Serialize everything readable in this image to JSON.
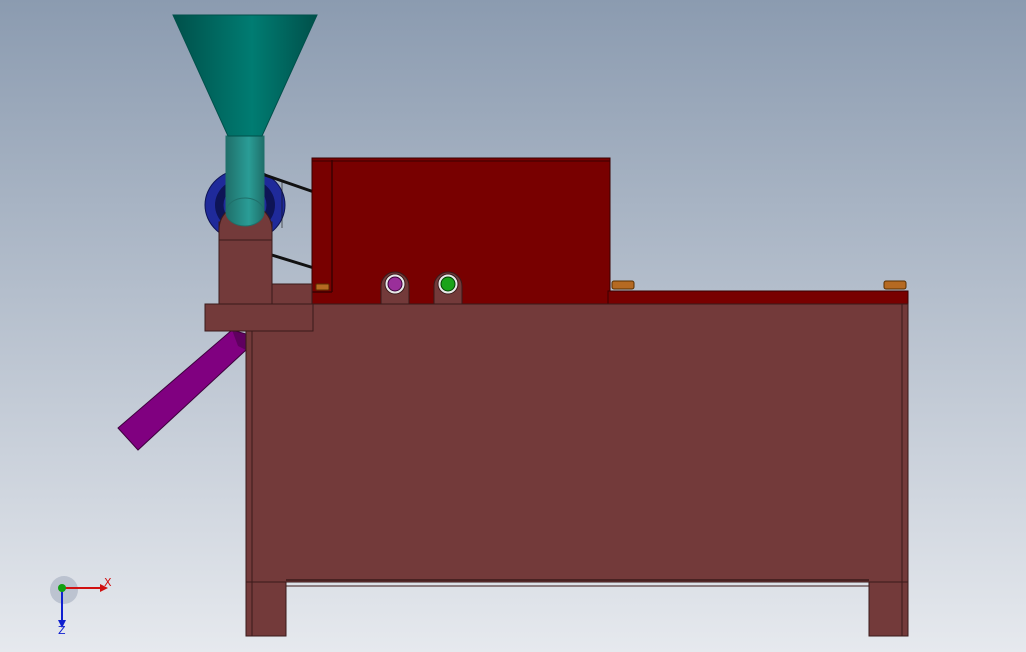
{
  "viewport": {
    "background_top": "#8b9bb0",
    "background_bottom": "#e6e9ee"
  },
  "model": {
    "hopper_icon": "funnel-hopper-icon",
    "colors": {
      "hopper_top": "#007c72",
      "hopper_shade": "#00504a",
      "tube": "#2a9d96",
      "tube_shade": "#1f6f6a",
      "frame": "#733a3a",
      "frame_edge": "#3a1a1a",
      "frame_dark": "#5e2e2e",
      "housing": "#780000",
      "housing_edge": "#3a0000",
      "chute": "#800080",
      "chute_edge": "#3d003d",
      "pulley": "#1f2a9a",
      "pulley_dark": "#0e1456",
      "belt": "#111111",
      "bolt": "#b56a22",
      "roller_purple": "#9a2f9a",
      "roller_green": "#1aa31a"
    }
  },
  "triad": {
    "x_label": "X",
    "z_label": "Z",
    "x_color": "#d01010",
    "y_color": "#10a010",
    "z_color": "#1020d0"
  }
}
